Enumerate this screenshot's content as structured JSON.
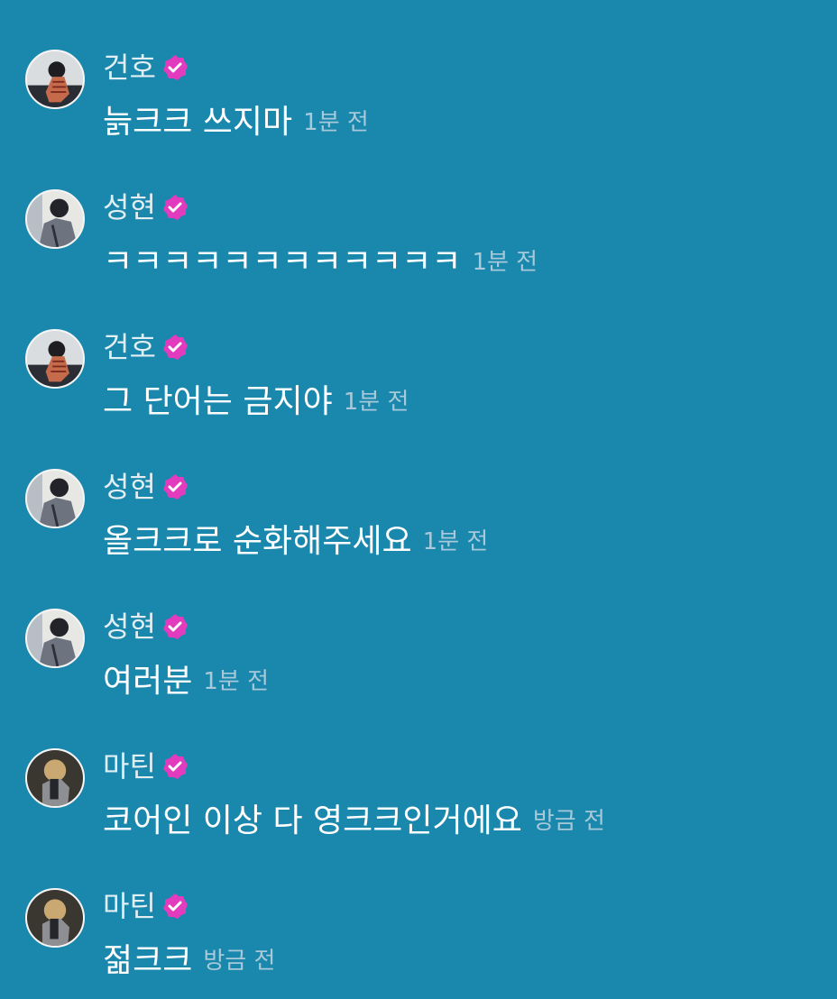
{
  "colors": {
    "background": "#1a87ad",
    "badge": "#e23bbd",
    "time": "#a7c9d9"
  },
  "messages": [
    {
      "name": "건호",
      "avatar_icon": "user-avatar-icon",
      "text": "늙크크 쓰지마",
      "time": "1분 전"
    },
    {
      "name": "성현",
      "avatar_icon": "user-avatar-icon",
      "text": "ㅋㅋㅋㅋㅋㅋㅋㅋㅋㅋㅋㅋ",
      "time": "1분 전"
    },
    {
      "name": "건호",
      "avatar_icon": "user-avatar-icon",
      "text": "그 단어는 금지야",
      "time": "1분 전"
    },
    {
      "name": "성현",
      "avatar_icon": "user-avatar-icon",
      "text": "올크크로 순화해주세요",
      "time": "1분 전"
    },
    {
      "name": "성현",
      "avatar_icon": "user-avatar-icon",
      "text": "여러분",
      "time": "1분 전"
    },
    {
      "name": "마틴",
      "avatar_icon": "user-avatar-icon",
      "text": "코어인 이상 다 영크크인거에요",
      "time": "방금 전"
    },
    {
      "name": "마틴",
      "avatar_icon": "user-avatar-icon",
      "text": "젊크크",
      "time": "방금 전"
    }
  ]
}
